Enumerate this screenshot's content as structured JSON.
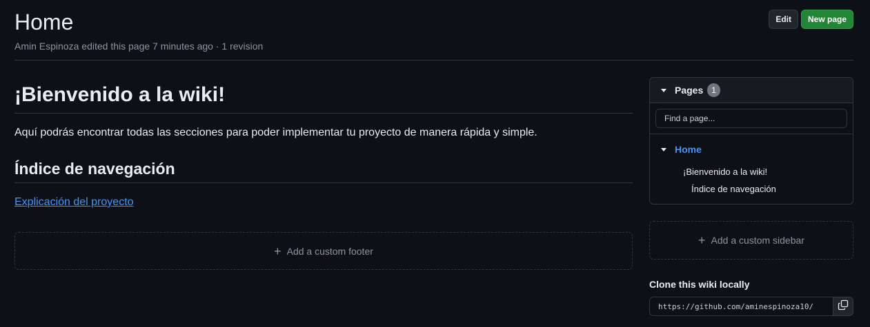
{
  "header": {
    "title": "Home",
    "author": "Amin Espinoza",
    "meta_text": "edited this page 7 minutes ago · 1 revision",
    "edit_label": "Edit",
    "new_page_label": "New page"
  },
  "content": {
    "heading1": "¡Bienvenido a la wiki!",
    "paragraph": "Aquí podrás encontrar todas las secciones para poder implementar tu proyecto de manera rápida y simple.",
    "heading2": "Índice de navegación",
    "link": "Explicación del proyecto",
    "footer_placeholder": "Add a custom footer"
  },
  "sidebar": {
    "pages_label": "Pages",
    "pages_count": "1",
    "find_placeholder": "Find a page...",
    "home_label": "Home",
    "toc": [
      "¡Bienvenido a la wiki!",
      "Índice de navegación"
    ],
    "custom_sidebar": "Add a custom sidebar",
    "clone_title": "Clone this wiki locally",
    "clone_url": "https://github.com/aminespinoza10/"
  },
  "colors": {
    "background": "#0d1117",
    "accent_link": "#4493f8",
    "primary_button": "#238636",
    "border": "#30363d"
  }
}
